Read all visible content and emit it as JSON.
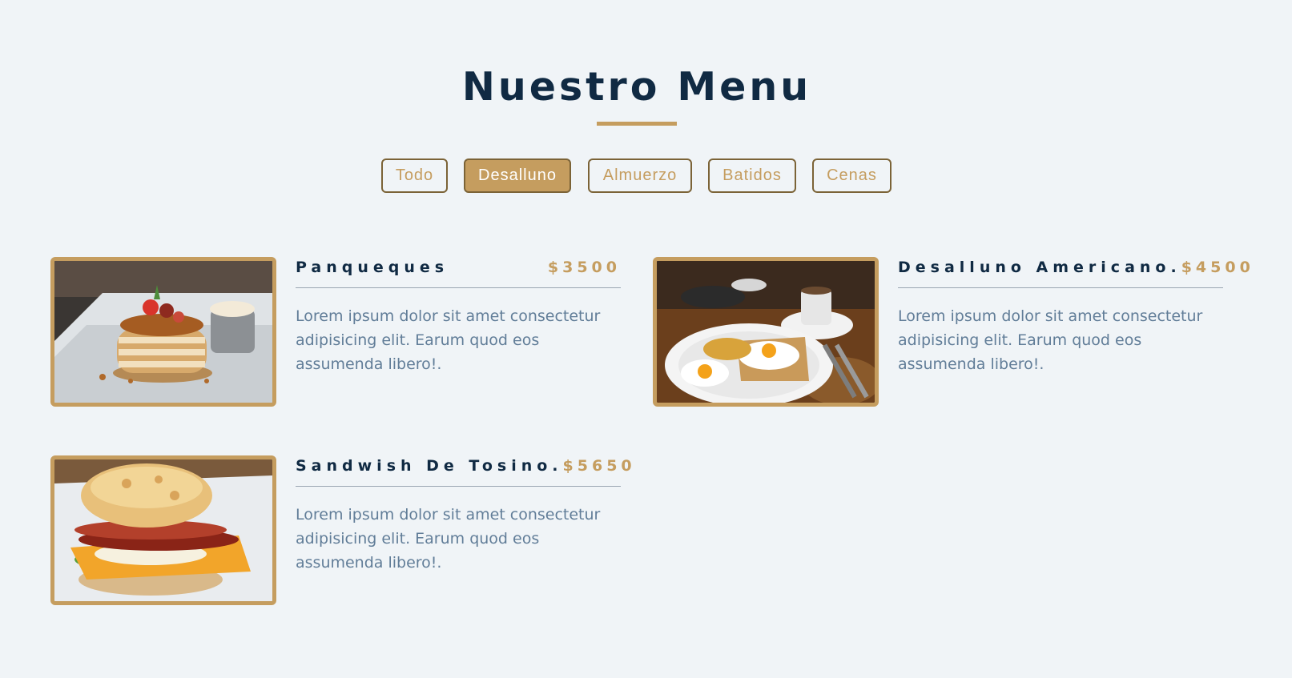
{
  "header": {
    "title": "Nuestro Menu"
  },
  "filters": [
    {
      "label": "Todo",
      "active": false
    },
    {
      "label": "Desalluno",
      "active": true
    },
    {
      "label": "Almuerzo",
      "active": false
    },
    {
      "label": "Batidos",
      "active": false
    },
    {
      "label": "Cenas",
      "active": false
    }
  ],
  "menu": {
    "items": [
      {
        "name": "Panqueques",
        "price": "$3500",
        "description": "Lorem ipsum dolor sit amet consectetur adipisicing elit. Earum quod eos assumenda libero!.",
        "image_icon": "pancakes-photo"
      },
      {
        "name": "Desalluno Americano.",
        "price": "$4500",
        "description": "Lorem ipsum dolor sit amet consectetur adipisicing elit. Earum quod eos assumenda libero!.",
        "image_icon": "breakfast-plate-photo"
      },
      {
        "name": "Sandwish De Tosino.",
        "price": "$5650",
        "description": "Lorem ipsum dolor sit amet consectetur adipisicing elit. Earum quod eos assumenda libero!.",
        "image_icon": "bacon-sandwich-photo"
      }
    ]
  },
  "colors": {
    "background": "#f0f4f7",
    "accent": "#c59d5f",
    "title": "#102a43",
    "text": "#617d98"
  }
}
